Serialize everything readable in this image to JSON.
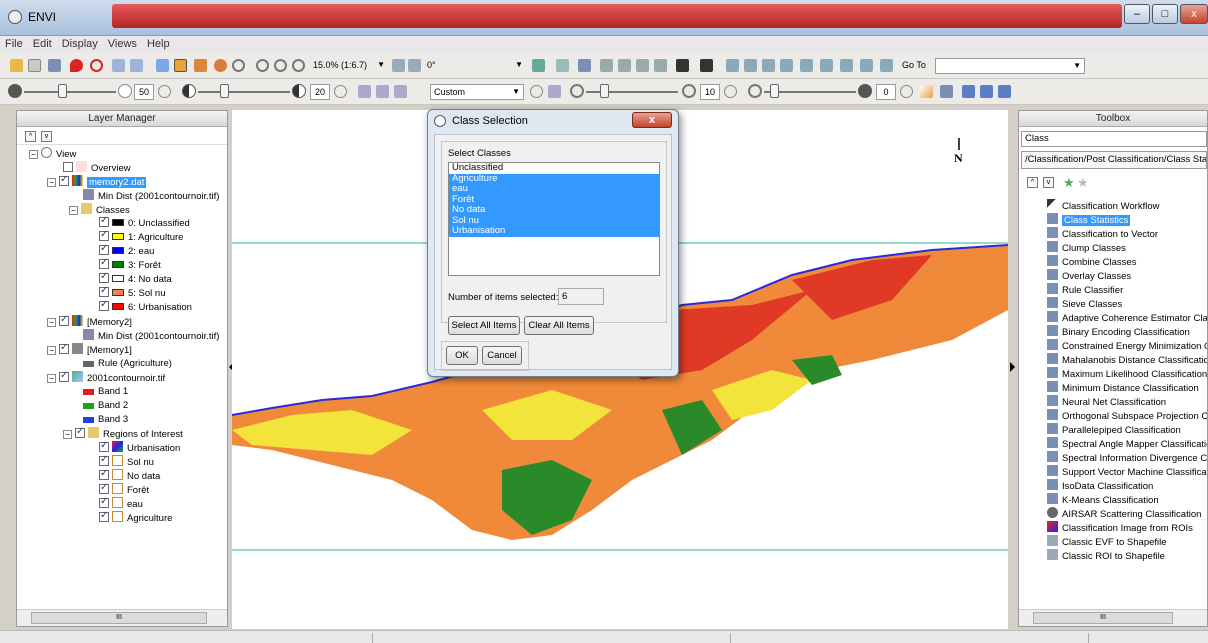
{
  "window": {
    "title": "ENVI",
    "min_label": "–",
    "max_label": "□",
    "close_label": "x"
  },
  "menu": [
    "File",
    "Edit",
    "Display",
    "Views",
    "Help"
  ],
  "toolbar": {
    "zoom": "15.0% (1:6.7)",
    "rotation": "0°",
    "goto_label": "Go To",
    "goto_value": "",
    "brightness": "50",
    "contrast": "20",
    "stretch": "Custom",
    "sharpen": "10",
    "transparency": "0"
  },
  "layer_manager": {
    "title": "Layer Manager",
    "root": "View",
    "overview": "Overview",
    "memory2_dat": "memory2.dat",
    "min_dist": "Min Dist (2001contournoir.tif)",
    "classes_folder": "Classes",
    "classes": [
      {
        "label": "0: Unclassified",
        "color": "#000000"
      },
      {
        "label": "1: Agriculture",
        "color": "#ffff00"
      },
      {
        "label": "2: eau",
        "color": "#0000ff"
      },
      {
        "label": "3: Forêt",
        "color": "#008000"
      },
      {
        "label": "4: No data",
        "color": "#ffffff"
      },
      {
        "label": "5: Sol nu",
        "color": "#ff7f50"
      },
      {
        "label": "6: Urbanisation",
        "color": "#ff0000"
      }
    ],
    "memory2": "[Memory2]",
    "memory2_child": "Min Dist (2001contournoir.tif)",
    "memory1": "[Memory1]",
    "memory1_child": "Rule (Agriculture)",
    "tif": "2001contournoir.tif",
    "bands": [
      {
        "label": "Band 1",
        "color": "#e02020"
      },
      {
        "label": "Band 2",
        "color": "#20a020"
      },
      {
        "label": "Band 3",
        "color": "#2040e0"
      }
    ],
    "roi_folder": "Regions of Interest",
    "rois": [
      "Urbanisation",
      "Sol nu",
      "No data",
      "Forêt",
      "eau",
      "Agriculture"
    ]
  },
  "dialog": {
    "title": "Class Selection",
    "group_label": "Select Classes",
    "items": [
      {
        "label": "Unclassified",
        "selected": false
      },
      {
        "label": "Agriculture",
        "selected": true
      },
      {
        "label": "eau",
        "selected": true
      },
      {
        "label": "Forêt",
        "selected": true
      },
      {
        "label": "No data",
        "selected": true
      },
      {
        "label": "Sol nu",
        "selected": true
      },
      {
        "label": "Urbanisation",
        "selected": true
      }
    ],
    "count_label": "Number of items selected:",
    "count_value": "6",
    "select_all": "Select All Items",
    "clear_all": "Clear All Items",
    "ok": "OK",
    "cancel": "Cancel"
  },
  "north_label": "N",
  "toolbox": {
    "title": "Toolbox",
    "search_value": "Class",
    "path": "/Classification/Post Classification/Class Statistics",
    "items": [
      "Classification Workflow",
      "Class Statistics",
      "Classification to Vector",
      "Clump Classes",
      "Combine Classes",
      "Overlay Classes",
      "Rule Classifier",
      "Sieve Classes",
      "Adaptive Coherence Estimator Classification",
      "Binary Encoding Classification",
      "Constrained Energy Minimization Classification",
      "Mahalanobis Distance Classification",
      "Maximum Likelihood Classification",
      "Minimum Distance Classification",
      "Neural Net Classification",
      "Orthogonal Subspace Projection Classification",
      "Parallelepiped Classification",
      "Spectral Angle Mapper Classification",
      "Spectral Information Divergence Classification",
      "Support Vector Machine Classification",
      "IsoData Classification",
      "K-Means Classification",
      "AIRSAR Scattering Classification",
      "Classification Image from ROIs",
      "Classic EVF to Shapefile",
      "Classic ROI to Shapefile"
    ],
    "selected_index": 1
  },
  "scroll_grip": "III",
  "colors": {
    "selection": "#3399ff",
    "teal_line": "#2bb3a0"
  }
}
